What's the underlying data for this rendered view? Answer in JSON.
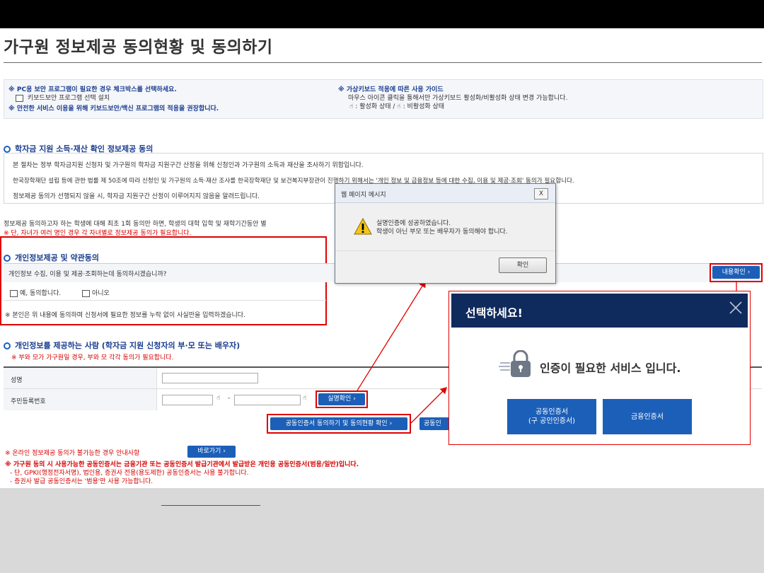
{
  "page": {
    "title": "가구원 정보제공 동의현황 및 동의하기"
  },
  "notice": {
    "pc_security_title": "※ PC용 보안 프로그램이 필요한 경우 체크박스를 선택하세요.",
    "keyboard_security_label": "키보드보안 프로그램 선택 설치",
    "recommend_text": "※ 안전한 서비스 이용을 위해 키보드보안/백신 프로그램의 적용을 권장합니다.",
    "virtual_kb_title": "※ 가상키보드 적용에 따른 사용 가이드",
    "virtual_kb_desc": "마우스 아이콘 클릭을 통해서만 가상키보드 활성화/비활성화 상태 변경 가능합니다.",
    "virtual_kb_states": ": 활성화 상태 / ",
    "virtual_kb_states2": ": 비활성화 상태"
  },
  "section1": {
    "heading": "학자금 지원 소득·재산 확인 정보제공 동의",
    "line1": "본 절차는 정부 학자금지원 신청자 및 가구원의 학자금 지원구간 산정을 위해 신청인과 가구원의 소득과 재산을 조사하기 위함입니다.",
    "line2": "한국장학재단 설립 등에 관한 법률 제 50조에 따라 신청인 및 가구원의 소득·재산 조사를 한국장학재단 및 보건복지부장관이 진행하기 위해서는 '개인 정보 및 금융정보 등에 대한 수집, 이용 및 제공·조회' 동의가 필요합니다.",
    "line3": "정보제공 동의가 선행되지 않을 시, 학자금 지원구간 산정이 이루어지지 않음을 알려드립니다.",
    "after1": "정보제공 동의하고자 하는 학생에 대해 최초 1회 동의만 하면, 학생의 대학 입학 및 재학기간동안 별",
    "after2": "※ 단, 자녀가 여러 명인 경우 각 자녀별로 정보제공 동의가 필요합니다."
  },
  "section2": {
    "heading": "개인정보제공 및 약관동의",
    "question": "개인정보 수집, 이용 및 제공·조회하는데 동의하시겠습니까?",
    "yes_label": "예, 동의합니다.",
    "no_label": "아니오",
    "view_button": "내용확인",
    "note": "※ 본인은 위 내용에 동의하며 신청서에 필요한 정보를 누락 없이 사실만을 입력하겠습니다."
  },
  "section3": {
    "heading": "개인정보를 제공하는 사람 (학자금 지원 신청자의 부·모 또는 배우자)",
    "subnote": "※ 부와 모가 가구원일 경우, 부와 모 각각 동의가 필요합니다.",
    "name_label": "성명",
    "rrn_label": "주민등록번호",
    "dash": "-",
    "verify_button": "실명확인",
    "cert_consent_button": "공동인증서 동의하기 및 동의현황 확인",
    "cert_cut_button": "공동인"
  },
  "bottom": {
    "offline_note": "※ 온라인 정보제공 동의가 불가능한 경우 안내사항",
    "go_button": "바로가기",
    "cert_note": "※ 가구원 동의 시 사용가능한 공동인증서는 금융기관 또는 공동인증서 발급기관에서 발급받은 개인용 공동인증서(범용/일반)입니다.",
    "sub1": "- 단, GPKI(행정전자서명), 법인용, 증권사 전용(용도제한) 공동인증서는 사용 불가합니다.",
    "sub2": "- 증권사 발급 공동인증서는 '범용'만 사용 가능합니다."
  },
  "dialog": {
    "title": "웹 페이지 메시지",
    "line1": "실명인증에 성공하였습니다.",
    "line2": "학생이 아닌 부모 또는 배우자가 동의해야 합니다.",
    "ok": "확인",
    "close": "X"
  },
  "modal": {
    "title": "선택하세요!",
    "message": "인증이 필요한 서비스 입니다.",
    "btn1_line1": "공동인증서",
    "btn1_line2": "(구 공인인증서)",
    "btn2": "금융인증서"
  },
  "colors": {
    "accent_blue": "#1c5fb8",
    "highlight_red": "#e00000",
    "modal_header": "#0f2a5c"
  }
}
